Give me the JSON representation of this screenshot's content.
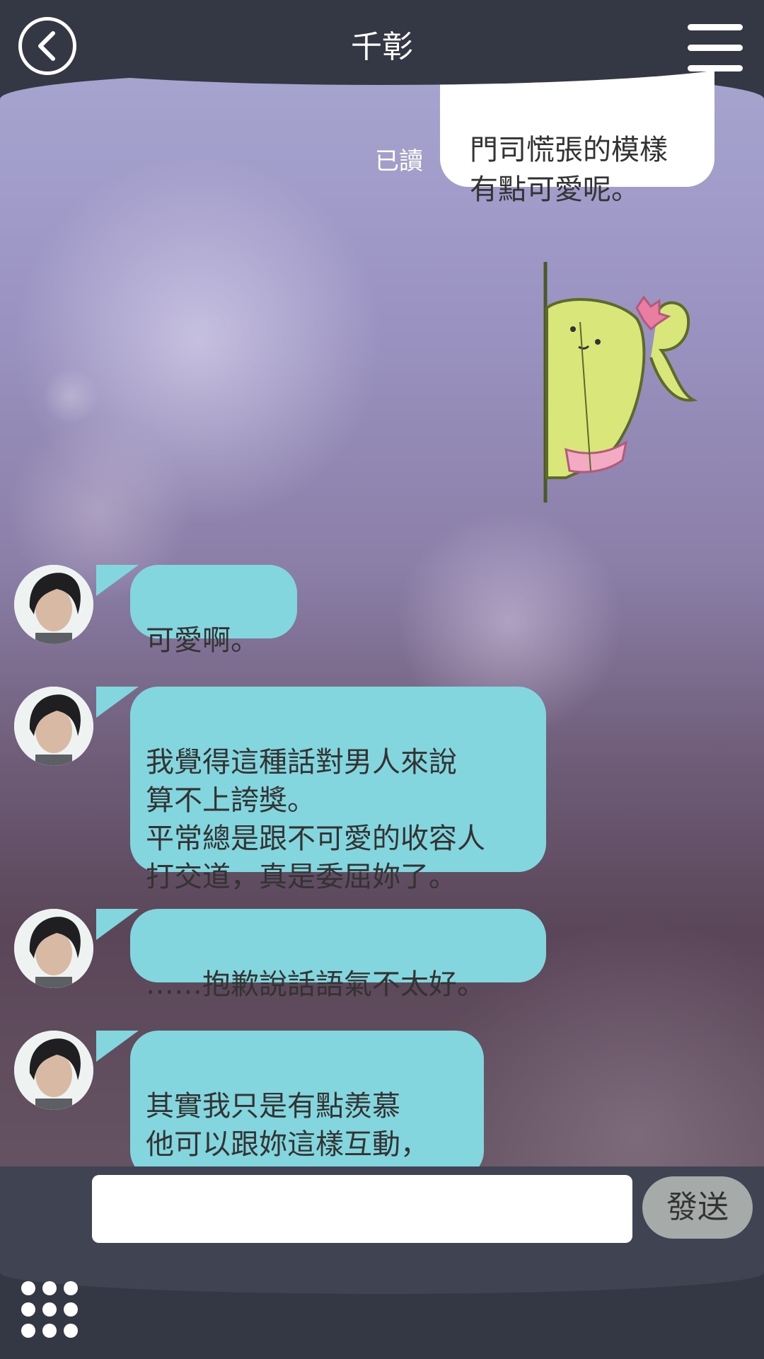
{
  "header": {
    "title": "千彰",
    "back_icon": "chevron-left-icon",
    "menu_icon": "hamburger-menu-icon"
  },
  "messages": {
    "outgoing": {
      "text": "門司慌張的模樣\n有點可愛呢。",
      "status": "已讀"
    },
    "sticker": {
      "icon": "cactus-peeking-sticker"
    },
    "incoming": [
      {
        "text": "可愛啊。"
      },
      {
        "text": "我覺得這種話對男人來說\n算不上誇獎。\n平常總是跟不可愛的收容人\n打交道，真是委屈妳了。"
      },
      {
        "text": "……抱歉說話語氣不太好。"
      },
      {
        "text": "其實我只是有點羨慕\n他可以跟妳這樣互動，\n妳不用太在意。"
      }
    ]
  },
  "composer": {
    "input_value": "",
    "send_label": "發送",
    "apps_icon": "grid-dots-icon"
  },
  "colors": {
    "bar": "#343744",
    "incoming_bubble": "#84d6de",
    "outgoing_bubble": "#ffffff",
    "send_button": "#a6aaa8"
  }
}
